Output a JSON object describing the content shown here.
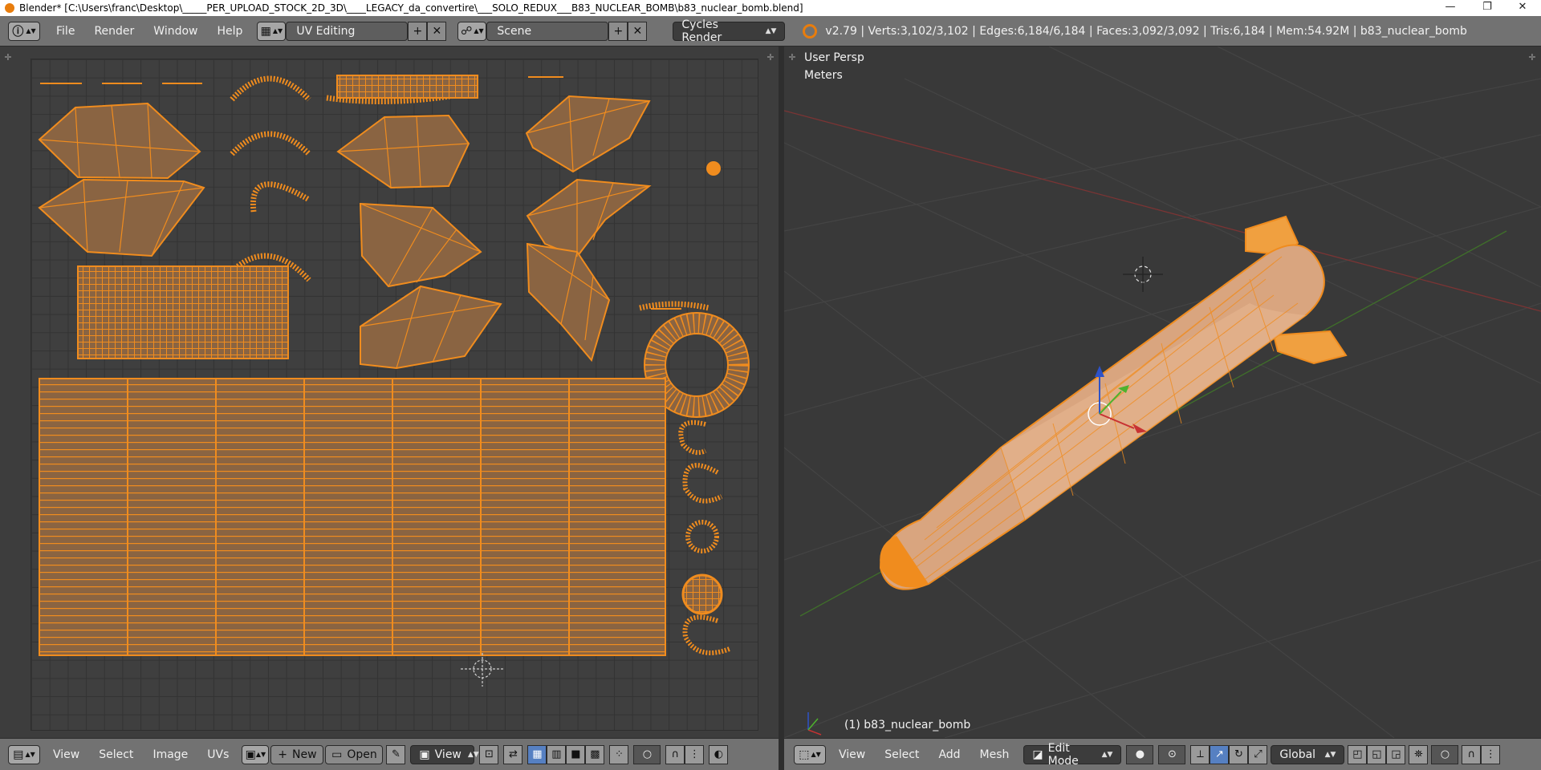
{
  "window": {
    "title": "Blender* [C:\\Users\\franc\\Desktop\\_____PER_UPLOAD_STOCK_2D_3D\\____LEGACY_da_convertire\\___SOLO_REDUX___B83_NUCLEAR_BOMB\\b83_nuclear_bomb.blend]",
    "minimize_glyph": "—",
    "restore_glyph": "❐",
    "close_glyph": "✕"
  },
  "info_header": {
    "editor_icon": "info-icon",
    "menus": [
      "File",
      "Render",
      "Window",
      "Help"
    ],
    "screen_layout": "UV Editing",
    "scene": "Scene",
    "render_engine": "Cycles Render",
    "stats": "v2.79 | Verts:3,102/3,102 | Edges:6,184/6,184 | Faces:3,092/3,092 | Tris:6,184 | Mem:54.92M | b83_nuclear_bomb",
    "add_glyph": "+",
    "remove_glyph": "✕"
  },
  "viewport": {
    "view_name": "User Persp",
    "units": "Meters",
    "object_label": "(1) b83_nuclear_bomb",
    "colors": {
      "mesh": "#f08c1e",
      "select": "#ffa030",
      "bg": "#393939",
      "grid": "#444444"
    }
  },
  "uv_editor_header": {
    "menus": [
      "View",
      "Select",
      "Image",
      "UVs"
    ],
    "new_label": "New",
    "open_label": "Open",
    "view_label": "View"
  },
  "view3d_header": {
    "menus": [
      "View",
      "Select",
      "Add",
      "Mesh"
    ],
    "mode": "Edit Mode",
    "orientation": "Global"
  },
  "colors": {
    "uv_fill": "#8a6442",
    "uv_edge": "#f08c1e",
    "uv_vert": "#ff8c1a"
  }
}
